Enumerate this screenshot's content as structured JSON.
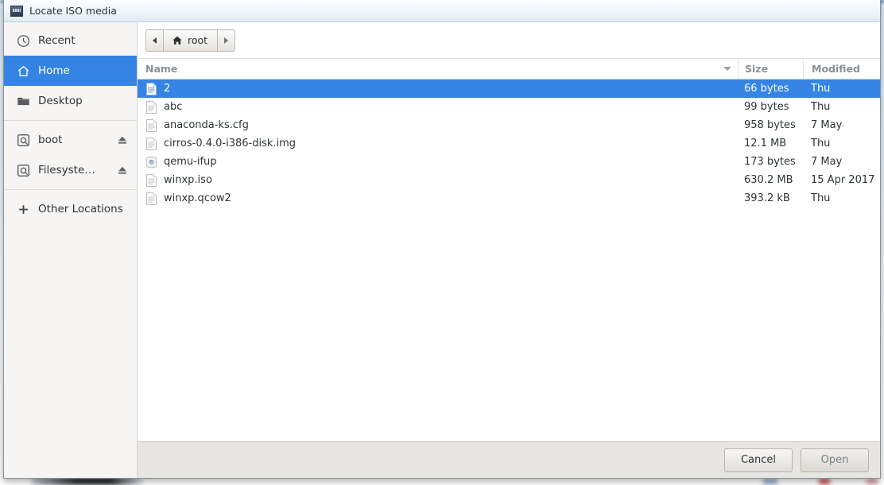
{
  "window": {
    "title": "Locate ISO media",
    "title_icon": "media-disc-icon",
    "close_label": "✖"
  },
  "sidebar": {
    "items": [
      {
        "label": "Recent",
        "icon": "clock-icon",
        "selected": false,
        "eject": false
      },
      {
        "label": "Home",
        "icon": "home-icon",
        "selected": true,
        "eject": false
      },
      {
        "label": "Desktop",
        "icon": "folder-icon",
        "selected": false,
        "eject": false
      },
      {
        "label": "boot",
        "icon": "drive-icon",
        "selected": false,
        "eject": true
      },
      {
        "label": "Filesyste…",
        "icon": "drive-icon",
        "selected": false,
        "eject": true
      },
      {
        "label": "Other Locations",
        "icon": "plus-icon",
        "selected": false,
        "eject": false
      }
    ],
    "separator_after": [
      2,
      4
    ]
  },
  "pathbar": {
    "back_label": "◀",
    "forward_label": "▶",
    "crumb_label": "root",
    "crumb_icon": "home-icon"
  },
  "columns": {
    "name": "Name",
    "size": "Size",
    "modified": "Modified",
    "sort_icon": "sort-descending-icon"
  },
  "files": [
    {
      "name": "2",
      "size": "66 bytes",
      "modified": "Thu",
      "icon": "text-file-icon",
      "selected": true
    },
    {
      "name": "abc",
      "size": "99 bytes",
      "modified": "Thu",
      "icon": "text-file-icon",
      "selected": false
    },
    {
      "name": "anaconda-ks.cfg",
      "size": "958 bytes",
      "modified": "7 May",
      "icon": "text-file-icon",
      "selected": false
    },
    {
      "name": "cirros-0.4.0-i386-disk.img",
      "size": "12.1 MB",
      "modified": "Thu",
      "icon": "text-file-icon",
      "selected": false
    },
    {
      "name": "qemu-ifup",
      "size": "173 bytes",
      "modified": "7 May",
      "icon": "script-file-icon",
      "selected": false
    },
    {
      "name": "winxp.iso",
      "size": "630.2 MB",
      "modified": "15 Apr 2017",
      "icon": "text-file-icon",
      "selected": false
    },
    {
      "name": "winxp.qcow2",
      "size": "393.2 kB",
      "modified": "Thu",
      "icon": "text-file-icon",
      "selected": false
    }
  ],
  "actions": {
    "cancel_label": "Cancel",
    "open_label": "Open"
  },
  "colors": {
    "selection": "#3584e4",
    "sidebar_bg": "#f6f5f4",
    "actionbar_bg": "#e8e6e3",
    "text": "#2e3436",
    "header_text": "#8b9094"
  }
}
